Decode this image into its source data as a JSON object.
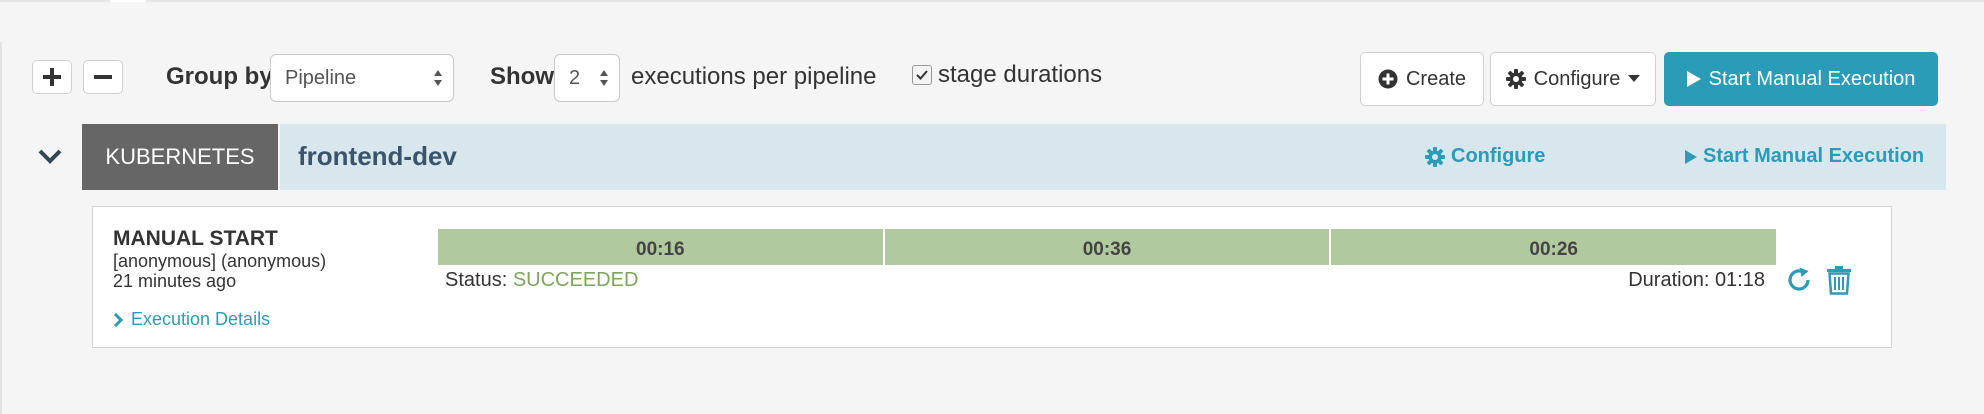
{
  "toolbar": {
    "group_by_label": "Group by",
    "group_by_value": "Pipeline",
    "show_label": "Show",
    "show_value": "2",
    "executions_label": "executions per pipeline",
    "stage_durations_label": "stage durations",
    "stage_durations_checked": true,
    "create_label": "Create",
    "configure_label": "Configure",
    "start_label": "Start Manual Execution"
  },
  "pipeline": {
    "account": "KUBERNETES",
    "name": "frontend-dev",
    "configure_label": "Configure",
    "start_label": "Start Manual Execution"
  },
  "execution": {
    "trigger": "MANUAL START",
    "user": "[anonymous] (anonymous)",
    "time_ago": "21 minutes ago",
    "details_label": "Execution Details",
    "stages": [
      "00:16",
      "00:36",
      "00:26"
    ],
    "status_label": "Status:",
    "status_value": "SUCCEEDED",
    "duration_label": "Duration:",
    "duration_value": "01:18"
  },
  "colors": {
    "accent": "#2a9cb8",
    "stage_success": "#b1c99f",
    "status_success": "#7ca65c",
    "header_bg": "#d8e6ee",
    "account_bg": "#666666"
  }
}
